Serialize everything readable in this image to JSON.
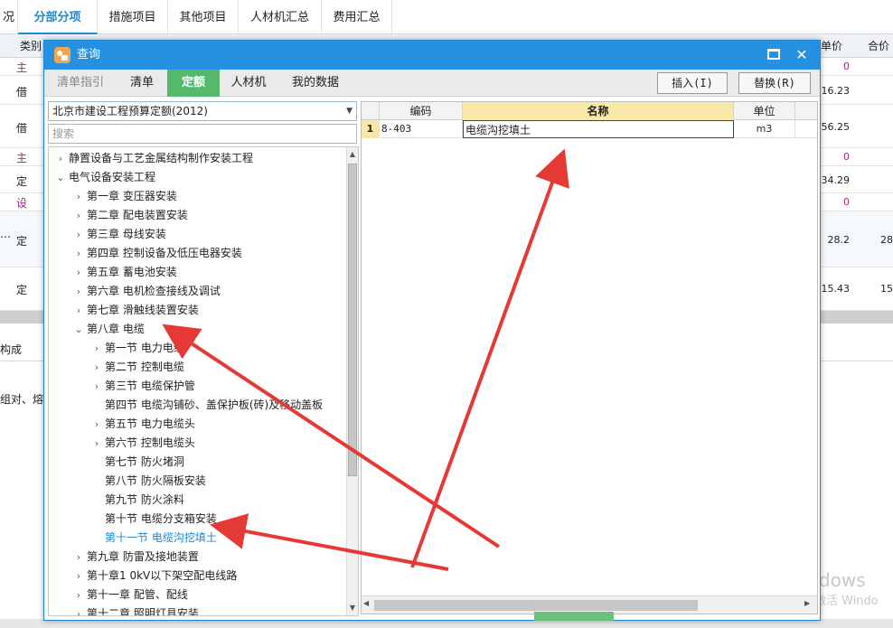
{
  "bg": {
    "tabs": [
      "况",
      "分部分项",
      "措施项目",
      "其他项目",
      "人材机汇总",
      "费用汇总"
    ],
    "head": {
      "col_type": "类别",
      "col_price": "单价",
      "col_total": "合价"
    },
    "rows": [
      {
        "type": "主",
        "price": "0",
        "total": ""
      },
      {
        "type": "借",
        "price": "16.23",
        "total": ""
      },
      {
        "type": "借",
        "price": "56.25",
        "total": ""
      },
      {
        "type": "主",
        "price": "0",
        "total": ""
      },
      {
        "type": "定",
        "price": "34.29",
        "total": ""
      },
      {
        "type": "设",
        "price": "0",
        "total": ""
      },
      {
        "type": "定",
        "price": "28.2",
        "total": "28"
      },
      {
        "type": "定",
        "price": "15.43",
        "total": "15"
      }
    ],
    "ellipsis": "…",
    "lower_tab": "构成",
    "lower_text": "组对、熔",
    "watermark1": "激活 Windows",
    "watermark2": "转到\"设置\"以激活 Windo"
  },
  "dialog": {
    "title": "查询",
    "tabs": [
      {
        "label": "清单指引",
        "state": "muted"
      },
      {
        "label": "清单",
        "state": ""
      },
      {
        "label": "定额",
        "state": "active"
      },
      {
        "label": "人材机",
        "state": ""
      },
      {
        "label": "我的数据",
        "state": ""
      }
    ],
    "insert_label": "插入(I)",
    "replace_label": "替换(R)",
    "combo_value": "北京市建设工程预算定额(2012)",
    "search_placeholder": "搜索",
    "tree": [
      {
        "label": "静置设备与工艺金属结构制作安装工程",
        "level": 0,
        "arrow": "›"
      },
      {
        "label": "电气设备安装工程",
        "level": 0,
        "arrow": "⌄"
      },
      {
        "label": "第一章  变压器安装",
        "level": 1,
        "arrow": "›"
      },
      {
        "label": "第二章  配电装置安装",
        "level": 1,
        "arrow": "›"
      },
      {
        "label": "第三章  母线安装",
        "level": 1,
        "arrow": "›"
      },
      {
        "label": "第四章  控制设备及低压电器安装",
        "level": 1,
        "arrow": "›"
      },
      {
        "label": "第五章  蓄电池安装",
        "level": 1,
        "arrow": "›"
      },
      {
        "label": "第六章  电机检查接线及调试",
        "level": 1,
        "arrow": "›"
      },
      {
        "label": "第七章  滑触线装置安装",
        "level": 1,
        "arrow": "›"
      },
      {
        "label": "第八章  电缆",
        "level": 1,
        "arrow": "⌄"
      },
      {
        "label": "第一节  电力电缆",
        "level": 2,
        "arrow": "›"
      },
      {
        "label": "第二节  控制电缆",
        "level": 2,
        "arrow": "›"
      },
      {
        "label": "第三节  电缆保护管",
        "level": 2,
        "arrow": "›"
      },
      {
        "label": "第四节  电缆沟铺砂、盖保护板(砖)及移动盖板",
        "level": 2,
        "arrow": ""
      },
      {
        "label": "第五节  电力电缆头",
        "level": 2,
        "arrow": "›"
      },
      {
        "label": "第六节  控制电缆头",
        "level": 2,
        "arrow": "›"
      },
      {
        "label": "第七节  防火堵洞",
        "level": 2,
        "arrow": ""
      },
      {
        "label": "第八节  防火隔板安装",
        "level": 2,
        "arrow": ""
      },
      {
        "label": "第九节  防火涂料",
        "level": 2,
        "arrow": ""
      },
      {
        "label": "第十节  电缆分支箱安装",
        "level": 2,
        "arrow": ""
      },
      {
        "label": "第十一节  电缆沟挖填土",
        "level": 2,
        "arrow": "",
        "selected": true
      },
      {
        "label": "第九章  防雷及接地装置",
        "level": 1,
        "arrow": "›"
      },
      {
        "label": "第十章1 0kV以下架空配电线路",
        "level": 1,
        "arrow": "›"
      },
      {
        "label": "第十一章  配管、配线",
        "level": 1,
        "arrow": "›"
      },
      {
        "label": "第十二章  照明灯具安装",
        "level": 1,
        "arrow": "›"
      }
    ],
    "grid": {
      "headers": {
        "code": "编码",
        "name": "名称",
        "unit": "单位"
      },
      "rows": [
        {
          "index": "1",
          "code": "8-403",
          "name": "电缆沟挖填土",
          "unit": "m3"
        }
      ]
    }
  },
  "colors": {
    "accent": "#2591e0",
    "tab_active": "#55b96b",
    "arrow": "#e53935"
  }
}
